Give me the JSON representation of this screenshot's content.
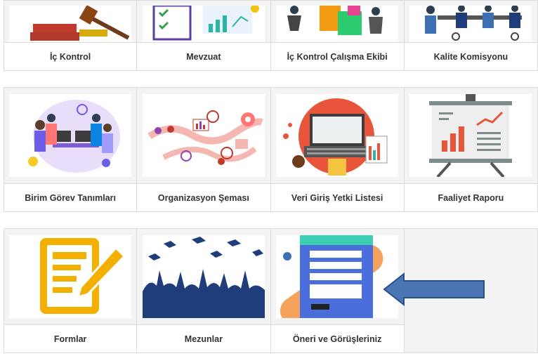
{
  "row1": [
    "İç Kontrol",
    "Mevzuat",
    "İç Kontrol Çalışma Ekibi",
    "Kalite Komisyonu"
  ],
  "row2": [
    "Birim Görev Tanımları",
    "Organizasyon Şeması",
    "Veri Giriş Yetki Listesi",
    "Faaliyet Raporu"
  ],
  "row3": [
    "Formlar",
    "Mezunlar",
    "Öneri ve Görüşleriniz"
  ],
  "colors": {
    "arrow": "#4a76b6",
    "form_icon": "#f4b000",
    "graduates": "#1f3d7a"
  }
}
